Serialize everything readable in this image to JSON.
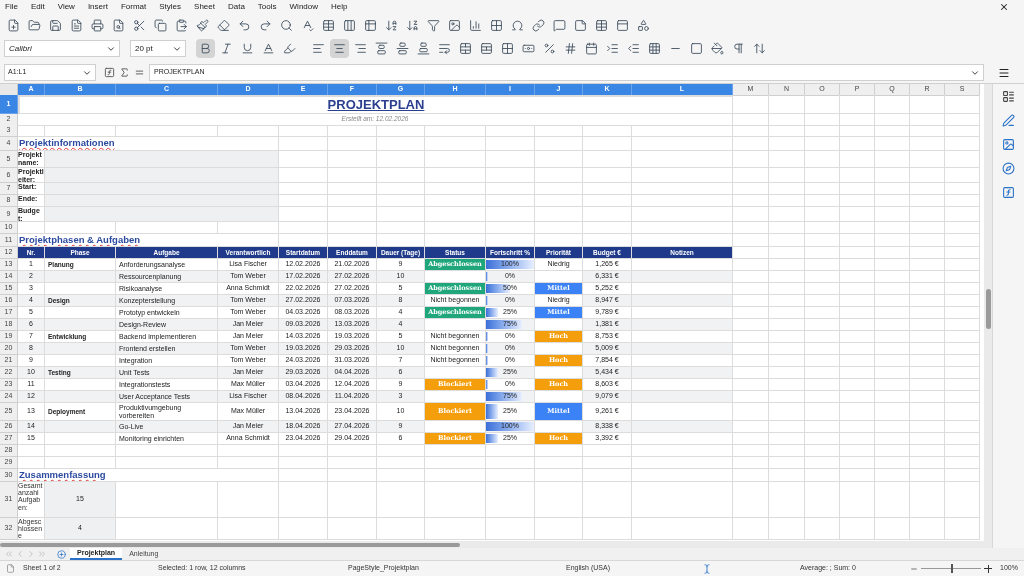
{
  "menu": [
    "File",
    "Edit",
    "View",
    "Insert",
    "Format",
    "Styles",
    "Sheet",
    "Data",
    "Tools",
    "Window",
    "Help"
  ],
  "toolbar": {
    "font_name": "Calibri",
    "font_size": "20 pt",
    "bold": true,
    "center_aligned": true
  },
  "formula_bar": {
    "cell_reference": "A1:L1",
    "content": "PROJEKTPLAN"
  },
  "columns": [
    {
      "label": "A",
      "selected": true
    },
    {
      "label": "B",
      "selected": true
    },
    {
      "label": "C",
      "selected": true
    },
    {
      "label": "D",
      "selected": true
    },
    {
      "label": "E",
      "selected": true
    },
    {
      "label": "F",
      "selected": true
    },
    {
      "label": "G",
      "selected": true
    },
    {
      "label": "H",
      "selected": true
    },
    {
      "label": "I",
      "selected": true
    },
    {
      "label": "J",
      "selected": true
    },
    {
      "label": "K",
      "selected": true
    },
    {
      "label": "L",
      "selected": true
    },
    {
      "label": "M",
      "selected": false
    },
    {
      "label": "N",
      "selected": false
    },
    {
      "label": "O",
      "selected": false
    },
    {
      "label": "P",
      "selected": false
    },
    {
      "label": "Q",
      "selected": false
    },
    {
      "label": "R",
      "selected": false
    },
    {
      "label": "S",
      "selected": false
    }
  ],
  "rows": [
    {
      "label": "1",
      "selected": true
    },
    {
      "label": "2",
      "selected": false
    },
    {
      "label": "3",
      "selected": false
    },
    {
      "label": "4",
      "selected": false
    },
    {
      "label": "5",
      "selected": false
    },
    {
      "label": "6",
      "selected": false
    },
    {
      "label": "7",
      "selected": false
    },
    {
      "label": "8",
      "selected": false
    },
    {
      "label": "9",
      "selected": false
    },
    {
      "label": "10",
      "selected": false
    },
    {
      "label": "11",
      "selected": false
    },
    {
      "label": "12",
      "selected": false
    },
    {
      "label": "13",
      "selected": false
    },
    {
      "label": "14",
      "selected": false
    },
    {
      "label": "15",
      "selected": false
    },
    {
      "label": "16",
      "selected": false
    },
    {
      "label": "17",
      "selected": false
    },
    {
      "label": "18",
      "selected": false
    },
    {
      "label": "19",
      "selected": false
    },
    {
      "label": "20",
      "selected": false
    },
    {
      "label": "21",
      "selected": false
    },
    {
      "label": "22",
      "selected": false
    },
    {
      "label": "23",
      "selected": false
    },
    {
      "label": "24",
      "selected": false
    },
    {
      "label": "25",
      "selected": false
    },
    {
      "label": "26",
      "selected": false
    },
    {
      "label": "27",
      "selected": false
    },
    {
      "label": "28",
      "selected": false
    },
    {
      "label": "29",
      "selected": false
    },
    {
      "label": "30",
      "selected": false
    },
    {
      "label": "31",
      "selected": false
    },
    {
      "label": "32",
      "selected": false
    }
  ],
  "sheet": {
    "title": "PROJEKTPLAN",
    "created": "Erstellt am: 12.02.2026",
    "info": {
      "heading": "Projektinformationen",
      "labels": [
        "Projektname:",
        "Projektleiter:",
        "Start:",
        "Ende:",
        "Budget:"
      ]
    },
    "tasks": {
      "heading": "Projektphasen & Aufgaben",
      "columns": [
        "Nr.",
        "Phase",
        "Aufgabe",
        "Verantwortlich",
        "Startdatum",
        "Enddatum",
        "Dauer (Tage)",
        "Status",
        "Fortschritt %",
        "Priorität",
        "Budget €",
        "Notizen"
      ],
      "rows": [
        {
          "nr": "1",
          "phase": "Planung",
          "task": "Anforderungsanalyse",
          "owner": "Lisa Fischer",
          "start": "12.02.2026",
          "end": "21.02.2026",
          "duration": "9",
          "status": {
            "kind": "done",
            "text": "Abgeschlossen"
          },
          "progress": {
            "text": "100%",
            "level": 1
          },
          "priority": {
            "kind": "low",
            "text": "Niedrig"
          },
          "budget": "1,265 €"
        },
        {
          "nr": "2",
          "task": "Ressourcenplanung",
          "owner": "Tom Weber",
          "start": "17.02.2026",
          "end": "27.02.2026",
          "duration": "10",
          "progress": {
            "text": "0%",
            "level": 0
          },
          "budget": "6,331 €"
        },
        {
          "nr": "3",
          "task": "Risikoanalyse",
          "owner": "Anna Schmidt",
          "start": "22.02.2026",
          "end": "27.02.2026",
          "duration": "5",
          "status": {
            "kind": "done",
            "text": "Abgeschlossen"
          },
          "progress": {
            "text": "50%",
            "level": 0.5
          },
          "priority": {
            "kind": "medium",
            "text": "Mittel"
          },
          "budget": "5,252 €"
        },
        {
          "nr": "4",
          "phase": "Design",
          "task": "Konzepterstellung",
          "owner": "Tom Weber",
          "start": "27.02.2026",
          "end": "07.03.2026",
          "duration": "8",
          "status": {
            "kind": "not_started",
            "text": "Nicht begonnen"
          },
          "progress": {
            "text": "0%",
            "level": 0
          },
          "priority": {
            "kind": "low",
            "text": "Niedrig"
          },
          "budget": "8,947 €"
        },
        {
          "nr": "5",
          "task": "Prototyp entwickeln",
          "owner": "Tom Weber",
          "start": "04.03.2026",
          "end": "08.03.2026",
          "duration": "4",
          "status": {
            "kind": "done",
            "text": "Abgeschlossen"
          },
          "progress": {
            "text": "25%",
            "level": 0.25
          },
          "priority": {
            "kind": "medium",
            "text": "Mittel"
          },
          "budget": "9,789 €"
        },
        {
          "nr": "6",
          "task": "Design-Review",
          "owner": "Jan Meier",
          "start": "09.03.2026",
          "end": "13.03.2026",
          "duration": "4",
          "progress": {
            "text": "75%",
            "level": 0.75
          },
          "budget": "1,381 €"
        },
        {
          "nr": "7",
          "phase": "Entwicklung",
          "task": "Backend implementieren",
          "owner": "Jan Meier",
          "start": "14.03.2026",
          "end": "19.03.2026",
          "duration": "5",
          "status": {
            "kind": "not_started",
            "text": "Nicht begonnen"
          },
          "progress": {
            "text": "0%",
            "level": 0
          },
          "priority": {
            "kind": "high",
            "text": "Hoch"
          },
          "budget": "8,753 €"
        },
        {
          "nr": "8",
          "task": "Frontend erstellen",
          "owner": "Tom Weber",
          "start": "19.03.2026",
          "end": "29.03.2026",
          "duration": "10",
          "status": {
            "kind": "not_started",
            "text": "Nicht begonnen"
          },
          "progress": {
            "text": "0%",
            "level": 0
          },
          "budget": "5,009 €"
        },
        {
          "nr": "9",
          "task": "Integration",
          "owner": "Tom Weber",
          "start": "24.03.2026",
          "end": "31.03.2026",
          "duration": "7",
          "status": {
            "kind": "not_started",
            "text": "Nicht begonnen"
          },
          "progress": {
            "text": "0%",
            "level": 0
          },
          "priority": {
            "kind": "high",
            "text": "Hoch"
          },
          "budget": "7,854 €"
        },
        {
          "nr": "10",
          "phase": "Testing",
          "task": "Unit Tests",
          "owner": "Jan Meier",
          "start": "29.03.2026",
          "end": "04.04.2026",
          "duration": "6",
          "progress": {
            "text": "25%",
            "level": 0.25
          },
          "budget": "5,434 €"
        },
        {
          "nr": "11",
          "task": "Integrationstests",
          "owner": "Max Müller",
          "start": "03.04.2026",
          "end": "12.04.2026",
          "duration": "9",
          "status": {
            "kind": "blocked",
            "text": "Blockiert"
          },
          "progress": {
            "text": "0%",
            "level": 0
          },
          "priority": {
            "kind": "high",
            "text": "Hoch"
          },
          "budget": "8,603 €"
        },
        {
          "nr": "12",
          "task": "User Acceptance Tests",
          "owner": "Lisa Fischer",
          "start": "08.04.2026",
          "end": "11.04.2026",
          "duration": "3",
          "progress": {
            "text": "75%",
            "level": 0.75
          },
          "budget": "9,079 €"
        },
        {
          "nr": "13",
          "phase": "Deployment",
          "task": "Produktivumgebung vorbereiten",
          "owner": "Max Müller",
          "start": "13.04.2026",
          "end": "23.04.2026",
          "duration": "10",
          "status": {
            "kind": "blocked",
            "text": "Blockiert"
          },
          "progress": {
            "text": "25%",
            "level": 0.25
          },
          "priority": {
            "kind": "medium",
            "text": "Mittel"
          },
          "budget": "9,261 €"
        },
        {
          "nr": "14",
          "task": "Go-Live",
          "owner": "Jan Meier",
          "start": "18.04.2026",
          "end": "27.04.2026",
          "duration": "9",
          "progress": {
            "text": "100%",
            "level": 1
          },
          "budget": "8,338 €"
        },
        {
          "nr": "15",
          "task": "Monitoring einrichten",
          "owner": "Anna Schmidt",
          "start": "23.04.2026",
          "end": "29.04.2026",
          "duration": "6",
          "status": {
            "kind": "blocked",
            "text": "Blockiert"
          },
          "progress": {
            "text": "25%",
            "level": 0.25
          },
          "priority": {
            "kind": "high",
            "text": "Hoch"
          },
          "budget": "3,392 €"
        }
      ]
    },
    "summary": {
      "heading": "Zusammenfassung",
      "items": [
        {
          "label": "Gesamtanzahl Aufgaben:",
          "value": "15"
        },
        {
          "label": "Abgeschlossene",
          "value": "4"
        }
      ]
    }
  },
  "sheet_tabs": [
    {
      "label": "Projektplan",
      "selected": true
    },
    {
      "label": "Anleitung",
      "selected": false
    }
  ],
  "status_bar": {
    "sheet": "Sheet 1 of 2",
    "selection": "Selected: 1 row, 12 columns",
    "page_style": "PageStyle_Projektplan",
    "language": "English (USA)",
    "summary": "Average: ; Sum: 0",
    "zoom_slider": {
      "level": 0.5
    },
    "zoom": "100%"
  }
}
